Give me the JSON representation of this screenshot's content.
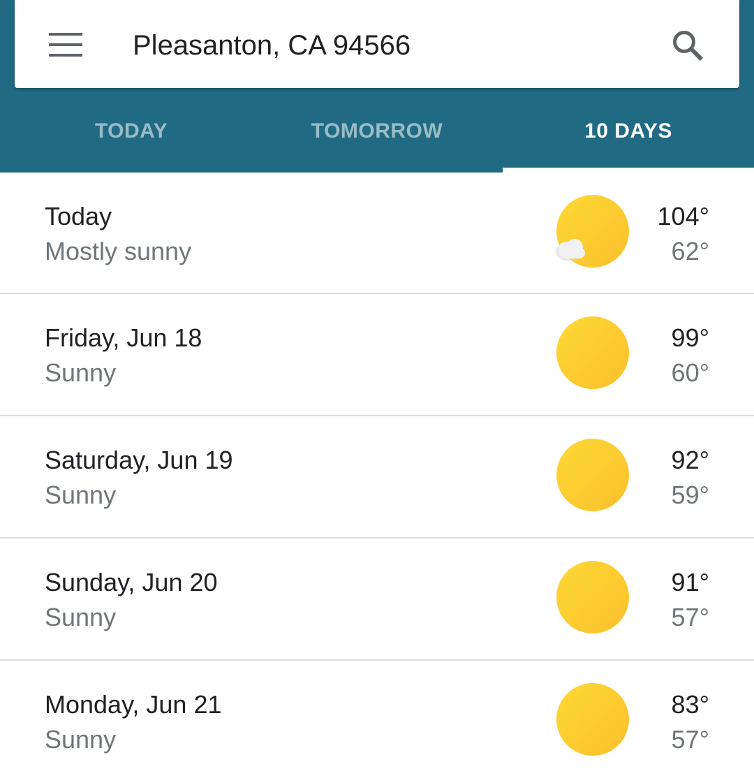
{
  "search": {
    "location": "Pleasanton, CA 94566"
  },
  "tabs": [
    {
      "label": "TODAY",
      "active": false
    },
    {
      "label": "TOMORROW",
      "active": false
    },
    {
      "label": "10 DAYS",
      "active": true
    }
  ],
  "colors": {
    "header": "#216a83",
    "sun": "#fdd835",
    "cloud": "#eeeeee"
  },
  "icons": {
    "menu": "menu-icon",
    "search": "search-icon"
  },
  "days": [
    {
      "name": "Today",
      "condition": "Mostly sunny",
      "high": "104°",
      "low": "62°",
      "icon": "mostly-sunny-icon"
    },
    {
      "name": "Friday, Jun 18",
      "condition": "Sunny",
      "high": "99°",
      "low": "60°",
      "icon": "sunny-icon"
    },
    {
      "name": "Saturday, Jun 19",
      "condition": "Sunny",
      "high": "92°",
      "low": "59°",
      "icon": "sunny-icon"
    },
    {
      "name": "Sunday, Jun 20",
      "condition": "Sunny",
      "high": "91°",
      "low": "57°",
      "icon": "sunny-icon"
    },
    {
      "name": "Monday, Jun 21",
      "condition": "Sunny",
      "high": "83°",
      "low": "57°",
      "icon": "sunny-icon"
    }
  ]
}
